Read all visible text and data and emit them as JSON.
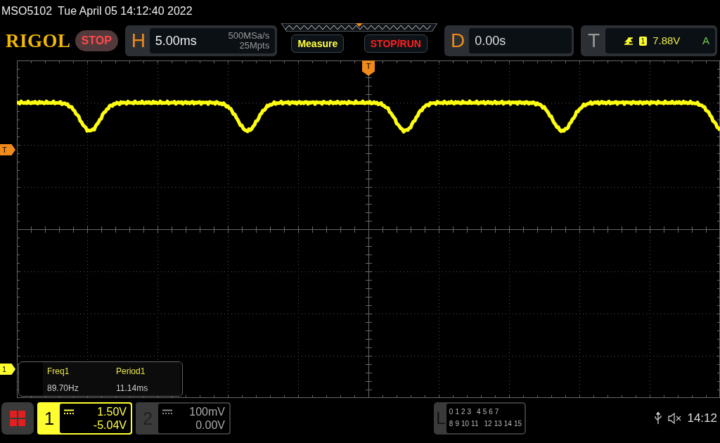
{
  "status_line": {
    "model": "MSO5102",
    "datetime": "Tue April 05 14:12:40 2022"
  },
  "logo": "RIGOL",
  "run_state": {
    "label": "STOP"
  },
  "horizontal": {
    "letter": "H",
    "timebase": "5.00ms",
    "sample_rate": "500MSa/s",
    "memory_depth": "25Mpts"
  },
  "buttons": [
    {
      "label": "Measure",
      "kind": "measure"
    },
    {
      "label": "STOP/RUN",
      "kind": "stoprun"
    }
  ],
  "delay": {
    "letter": "D",
    "value": "0.00s"
  },
  "trigger": {
    "letter": "T",
    "source": "1",
    "level": "7.88V",
    "mode": "A"
  },
  "markers": [
    {
      "label": "T",
      "kind": "trigger-position"
    },
    {
      "label": "T",
      "kind": "trigger-level"
    },
    {
      "label": "1",
      "kind": "channel-offset"
    }
  ],
  "measurements": [
    {
      "name": "Freq1",
      "value": "89.70Hz"
    },
    {
      "name": "Period1",
      "value": "11.14ms"
    }
  ],
  "channels": [
    {
      "number": "1",
      "scale": "1.50V",
      "offset": "-5.04V",
      "selected": true
    },
    {
      "number": "2",
      "scale": "100mV",
      "offset": "0.00V",
      "selected": false
    }
  ],
  "logic": {
    "letter": "L",
    "row_1": [
      "0",
      "1",
      "2",
      "3",
      "4",
      "5",
      "6",
      "7"
    ],
    "row_2": [
      "8",
      "9",
      "10",
      "11",
      "12",
      "13",
      "14",
      "15"
    ]
  },
  "clock": "14:12"
}
